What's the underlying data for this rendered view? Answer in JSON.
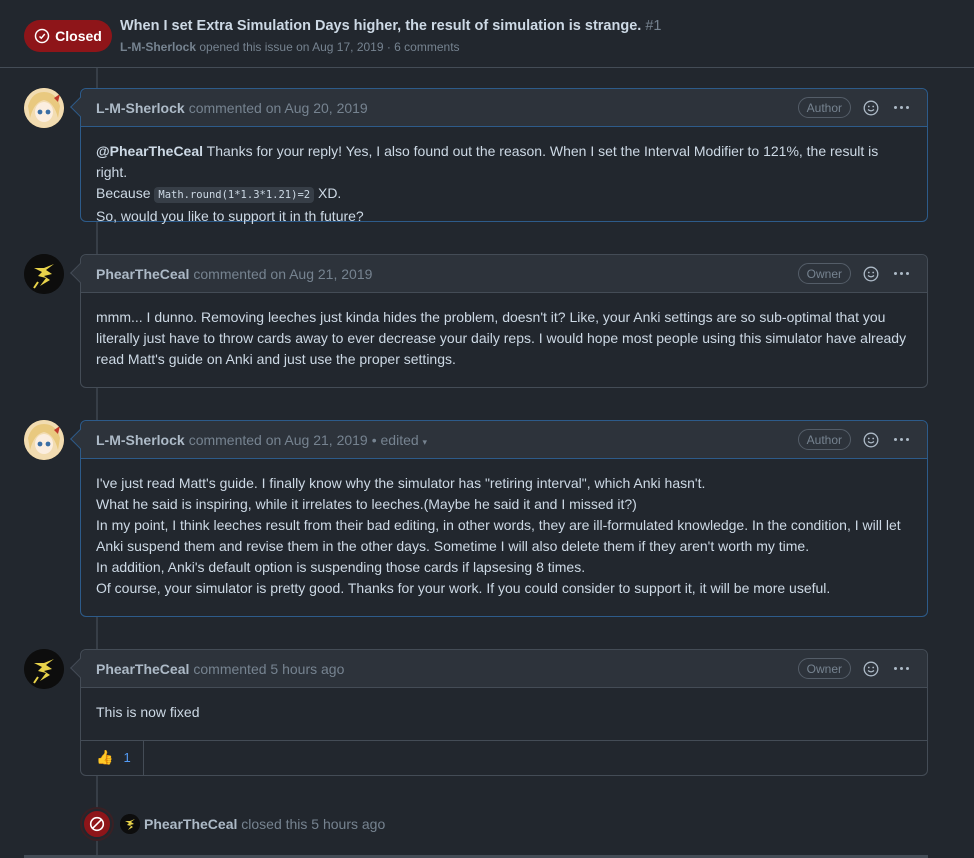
{
  "issue": {
    "state": "Closed",
    "title": "When I set Extra Simulation Days higher, the result of simulation is strange.",
    "number": "#1",
    "author": "L-M-Sherlock",
    "meta": "opened this issue on Aug 17, 2019 · 6 comments"
  },
  "comments": [
    {
      "author": "L-M-Sherlock",
      "action": "commented on Aug 20, 2019",
      "role": "Author",
      "mention": "@PhearTheCeal",
      "line1": " Thanks for your reply! Yes, I also found out the reason. When I set the Interval Modifier to 121%, the result is right.",
      "line2_pre": "Because ",
      "code": "Math.round(1*1.3*1.21)=2",
      "line2_post": " XD.",
      "line3": "So, would you like to support it in th future?"
    },
    {
      "author": "PhearTheCeal",
      "action": "commented on Aug 21, 2019",
      "role": "Owner",
      "body": "mmm... I dunno. Removing leeches just kinda hides the problem, doesn't it? Like, your Anki settings are so sub-optimal that you literally just have to throw cards away to ever decrease your daily reps. I would hope most people using this simulator have already read Matt's guide on Anki and just use the proper settings."
    },
    {
      "author": "L-M-Sherlock",
      "action": "commented on Aug 21, 2019",
      "edited": "• edited",
      "role": "Author",
      "lines": [
        "I've just read Matt's guide. I finally know why the simulator has \"retiring interval\", which Anki hasn't.",
        "What he said is inspiring, while it irrelates to leeches.(Maybe he said it and I missed it?)",
        "In my point, I think leeches result from their bad editing, in other words, they are ill-formulated knowledge. In the condition, I will let Anki suspend them and revise them in the other days. Sometime I will also delete them if they aren't worth my time.",
        "In addition, Anki's default option is suspending those cards if lapsesing 8 times.",
        "Of course, your simulator is pretty good. Thanks for your work. If you could consider to support it, it will be more useful."
      ]
    },
    {
      "author": "PhearTheCeal",
      "action": "commented 5 hours ago",
      "role": "Owner",
      "body": "This is now fixed",
      "reaction_count": "1"
    }
  ],
  "closed_event": {
    "actor": "PhearTheCeal",
    "text": "closed this 5 hours ago"
  },
  "colors": {
    "background": "#22272e",
    "closed_red": "#8e1519",
    "link_blue": "#539bf5",
    "focus_border": "#2d5b8a"
  }
}
